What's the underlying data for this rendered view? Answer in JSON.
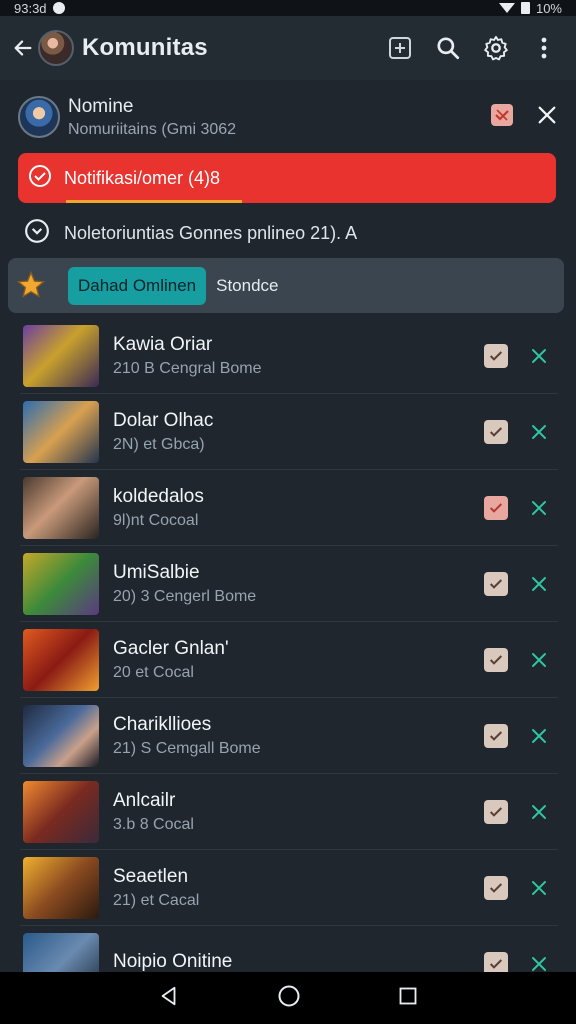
{
  "status_bar": {
    "left_text": "93:3d",
    "right_text": "10%"
  },
  "app_bar": {
    "title": "Komunitas",
    "icons": [
      "back-arrow-icon",
      "add-box-icon",
      "search-icon",
      "gear-icon",
      "more-vert-icon"
    ]
  },
  "header": {
    "name": "Nomine",
    "subtitle": "Nomuriitains (Gmi 3062"
  },
  "alert": {
    "text": "Notifikasi/omer (4)8",
    "color": "#e8332f"
  },
  "info": {
    "text": "Noletoriuntias Gonnes  pnlineo 21). A"
  },
  "filter": {
    "chip_label": "Dahad Omlinen",
    "secondary_label": "Stondce"
  },
  "items": [
    {
      "title": "Kawia Oriar",
      "meta": "210 B Cengral Bome",
      "check_color": "neutral"
    },
    {
      "title": "Dolar Olhac",
      "meta": "2N) et Gbca)",
      "check_color": "neutral"
    },
    {
      "title": "koldedalos",
      "meta": "9l)nt Cocoal",
      "check_color": "red"
    },
    {
      "title": "UmiSalbie",
      "meta": "20) 3 Cengerl Bome",
      "check_color": "neutral"
    },
    {
      "title": "Gacler Gnlan'",
      "meta": "20 et Cocal",
      "check_color": "neutral"
    },
    {
      "title": "Charikllioes",
      "meta": "21) S Cemgall Bome",
      "check_color": "neutral"
    },
    {
      "title": "Anlcailr",
      "meta": "3.b 8 Cocal",
      "check_color": "neutral"
    },
    {
      "title": "Seaetlen",
      "meta": "21) et Cacal",
      "check_color": "neutral"
    },
    {
      "title": "Noipio Onitine",
      "meta": "",
      "check_color": "neutral"
    }
  ],
  "colors": {
    "accent_teal": "#169ea0",
    "x_green": "#2fc7a0",
    "background": "#1f262e"
  }
}
